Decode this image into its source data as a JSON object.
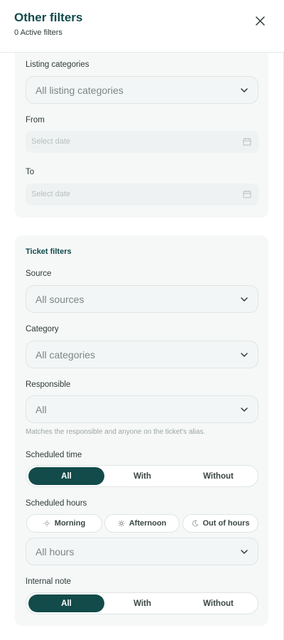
{
  "header": {
    "title": "Other filters",
    "subtitle": "0 Active filters",
    "close_icon": "close-icon"
  },
  "listing": {
    "categories_label": "Listing categories",
    "categories_value": "All listing categories",
    "from_label": "From",
    "from_placeholder": "Select date",
    "to_label": "To",
    "to_placeholder": "Select date"
  },
  "ticket": {
    "section_title": "Ticket filters",
    "source_label": "Source",
    "source_value": "All sources",
    "category_label": "Category",
    "category_value": "All categories",
    "responsible_label": "Responsible",
    "responsible_value": "All",
    "responsible_helper": "Matches the responsible and anyone on the ticket's alias.",
    "scheduled_time_label": "Scheduled time",
    "scheduled_time_options": [
      "All",
      "With",
      "Without"
    ],
    "scheduled_time_selected": "All",
    "scheduled_hours_label": "Scheduled hours",
    "scheduled_hours_chips": [
      "Morning",
      "Afternoon",
      "Out of hours"
    ],
    "scheduled_hours_value": "All hours",
    "internal_note_label": "Internal note",
    "internal_note_options": [
      "All",
      "With",
      "Without"
    ],
    "internal_note_selected": "All"
  },
  "colors": {
    "accent": "#124b4a",
    "card_bg": "#f6f8f8",
    "border": "#dfe5e4"
  }
}
